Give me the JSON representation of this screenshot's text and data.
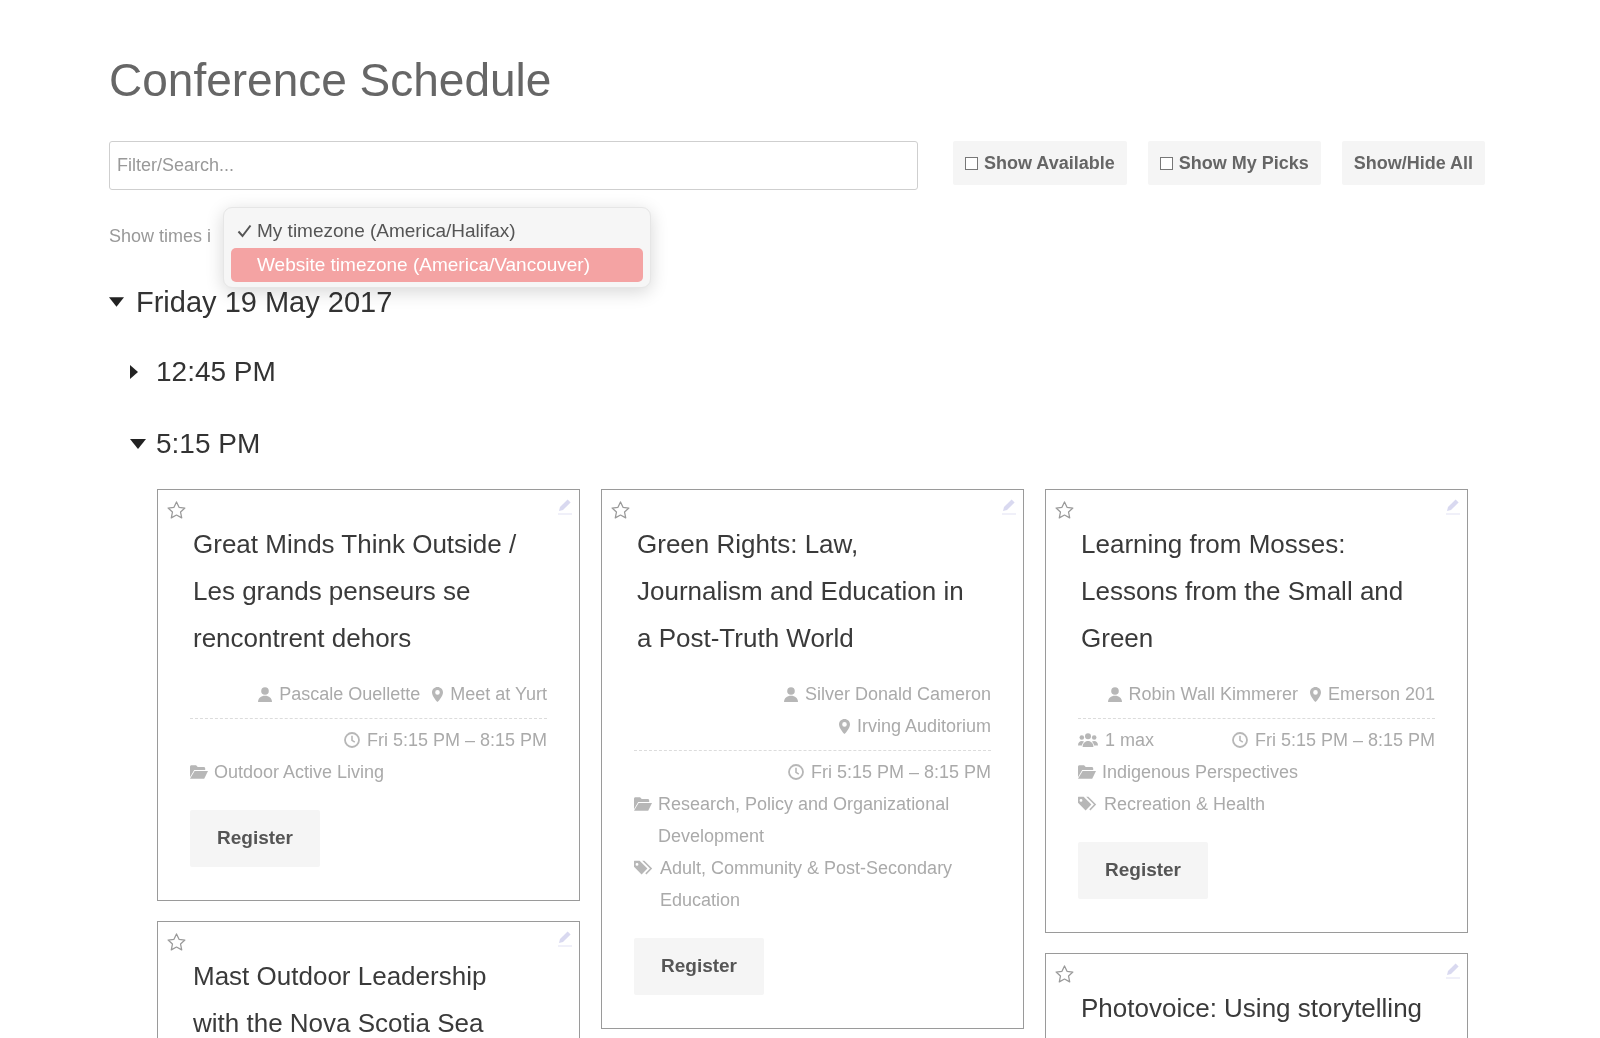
{
  "page_title": "Conference Schedule",
  "toolbar": {
    "search": {
      "placeholder": "Filter/Search..."
    },
    "buttons": [
      {
        "kind": "checkbox",
        "label": "Show Available",
        "checked": false
      },
      {
        "kind": "checkbox",
        "label": "Show My Picks",
        "checked": false
      },
      {
        "kind": "button",
        "label": "Show/Hide All"
      }
    ]
  },
  "timezone": {
    "label": "Show times i",
    "menu": [
      {
        "label": "My timezone (America/Halifax)",
        "selected": true,
        "highlighted": false
      },
      {
        "label": "Website timezone (America/Vancouver)",
        "selected": false,
        "highlighted": true
      }
    ]
  },
  "days": [
    {
      "label": "Friday 19 May 2017",
      "expanded": true,
      "time_slots": [
        {
          "label": "12:45 PM",
          "expanded": false
        },
        {
          "label": "5:15 PM",
          "expanded": true,
          "sessions": [
            {
              "title": "Great Minds Think Outside / Les grands penseurs se rencontrent dehors",
              "starred": false,
              "presenter": "Pascale Ouellette",
              "location": "Meet at Yurt",
              "time": "Fri 5:15 PM – 8:15 PM",
              "category": "Outdoor Active Living",
              "register": "Register"
            },
            {
              "title": "Green Rights: Law, Journalism and Education in a Post-Truth World",
              "starred": false,
              "presenter": "Silver Donald Cameron",
              "location": "Irving Auditorium",
              "time": "Fri 5:15 PM – 8:15 PM",
              "category": "Research, Policy and Organizational Development",
              "tag": "Adult, Community & Post-Secondary Education",
              "register": "Register"
            },
            {
              "title": "Learning from Mosses: Lessons from the Small and Green",
              "starred": false,
              "presenter": "Robin Wall Kimmerer",
              "location": "Emerson 201",
              "capacity": "1 max",
              "time": "Fri 5:15 PM – 8:15 PM",
              "category": "Indigenous Perspectives",
              "tag": "Recreation & Health",
              "register": "Register"
            },
            {
              "title": "Mast Outdoor Leadership with the Nova Scotia Sea",
              "starred": false
            },
            {
              "title": "Photovoice: Using storytelling",
              "starred": false
            }
          ]
        }
      ]
    }
  ]
}
